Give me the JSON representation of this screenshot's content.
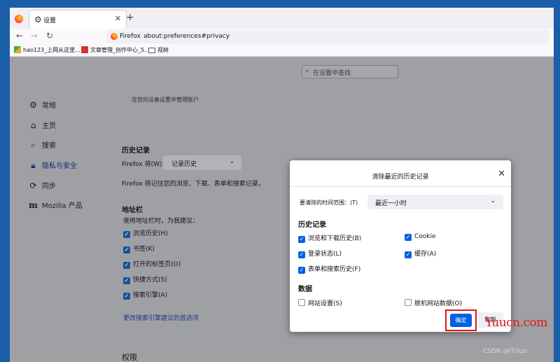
{
  "tab": {
    "title": "设置",
    "close": "✕",
    "new_tab": "+"
  },
  "nav": {
    "back": "←",
    "forward": "→",
    "reload": "↻"
  },
  "urlbar": {
    "identity": "Firefox",
    "url": "about:preferences#privacy"
  },
  "bookmarks": [
    {
      "label": "hao123_上网从这里..."
    },
    {
      "label": "文章管理_创作中心_5..."
    },
    {
      "label": "视树"
    }
  ],
  "search": {
    "placeholder": "在设置中查找"
  },
  "sidebar": {
    "items": [
      {
        "label": "常规",
        "icon": "gear-icon"
      },
      {
        "label": "主页",
        "icon": "home-icon"
      },
      {
        "label": "搜索",
        "icon": "search-icon"
      },
      {
        "label": "隐私与安全",
        "icon": "lock-icon"
      },
      {
        "label": "同步",
        "icon": "sync-icon"
      },
      {
        "label": "Mozilla 产品",
        "icon": "mozilla-icon"
      }
    ]
  },
  "managed_notice": "在您的设备设置中管理账户",
  "history": {
    "title": "历史记录",
    "mode_label": "Firefox 将(W)",
    "mode_value": "记录历史",
    "description": "Firefox 将记住您的浏览、下载、表单和搜索记录。"
  },
  "address_bar": {
    "title": "地址栏",
    "description": "使用地址栏时，为我建议：",
    "options": [
      {
        "label": "浏览历史(H)",
        "checked": true
      },
      {
        "label": "书签(K)",
        "checked": true
      },
      {
        "label": "打开的标签页(O)",
        "checked": true
      },
      {
        "label": "快捷方式(S)",
        "checked": true
      },
      {
        "label": "搜索引擎(A)",
        "checked": true
      }
    ],
    "link": "更改搜索引擎建议的首选项"
  },
  "permissions": {
    "title": "权限"
  },
  "dialog": {
    "title": "清除最近的历史记录",
    "close": "✕",
    "range_label": "要清除的时间范围：(T)",
    "range_value": "最近一小时",
    "history_title": "历史记录",
    "history_items": [
      {
        "label": "浏览和下载历史(B)",
        "checked": true
      },
      {
        "label": "Cookie",
        "checked": true
      },
      {
        "label": "登录状态(L)",
        "checked": true
      },
      {
        "label": "缓存(A)",
        "checked": true
      },
      {
        "label": "表单和搜索历史(F)",
        "checked": true
      }
    ],
    "data_title": "数据",
    "data_items": [
      {
        "label": "网站设置(S)",
        "checked": false
      },
      {
        "label": "脱机网站数据(O)",
        "checked": false
      }
    ],
    "ok_label": "确定",
    "cancel_label": "取消"
  },
  "watermark": {
    "site": "Yuucn.com",
    "credit": "CSDN @ITduo"
  },
  "colors": {
    "accent": "#0061e0",
    "highlight": "#e0141e",
    "desktop": "#1a5ea8"
  }
}
